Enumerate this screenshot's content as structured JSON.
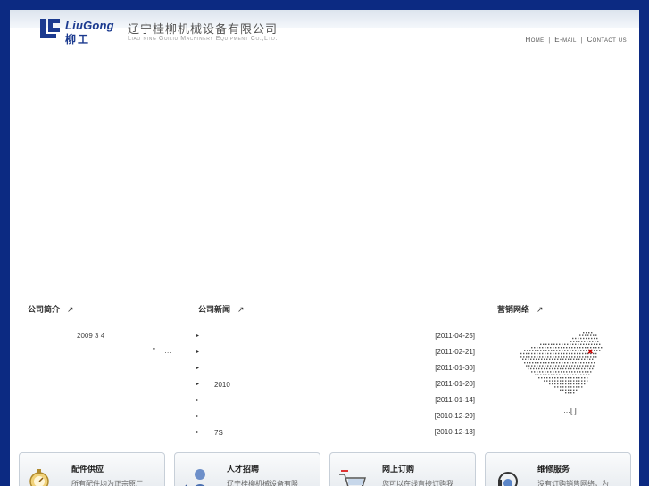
{
  "header": {
    "logo_en": "LiuGong",
    "logo_cn": "柳工",
    "company_name": "辽宁桂柳机械设备有限公司",
    "company_en": "Liao ning Guiliu Machinery Equipment Co.,Ltd.",
    "links": [
      "Home",
      "E-mail",
      "Contact us"
    ],
    "link_separator": "|"
  },
  "intro": {
    "title": "公司简介",
    "arrow": "↗",
    "line1": "2009 3 4",
    "line2": "\" …"
  },
  "news": {
    "title": "公司新闻",
    "arrow": "↗",
    "items": [
      {
        "bullet": "▸",
        "title": "",
        "date": "[2011-04-25]"
      },
      {
        "bullet": "▸",
        "title": "",
        "date": "[2011-02-21]"
      },
      {
        "bullet": "▸",
        "title": "",
        "date": "[2011-01-30]"
      },
      {
        "bullet": "▸",
        "title": "2010",
        "date": "[2011-01-20]"
      },
      {
        "bullet": "▸",
        "title": "",
        "date": "[2011-01-14]"
      },
      {
        "bullet": "▸",
        "title": "",
        "date": "[2010-12-29]"
      },
      {
        "bullet": "▸",
        "title": "7S",
        "date": "[2010-12-13]"
      }
    ]
  },
  "network": {
    "title": "营销网络",
    "arrow": "↗",
    "more": "…[  ]",
    "marker_color": "#cc0000"
  },
  "cards": [
    {
      "title": "配件供应",
      "desc": "所有配件均为正宗原厂",
      "icon": "stopwatch-icon"
    },
    {
      "title": "人才招聘",
      "desc": "辽宁桂柳机械设备有限",
      "icon": "person-icon"
    },
    {
      "title": "网上订购",
      "desc": "您可以在线直接订购我",
      "icon": "cart-icon"
    },
    {
      "title": "维修服务",
      "desc": "没有订购销售网络，为",
      "icon": "headset-icon"
    }
  ],
  "colors": {
    "frame": "#0c2a82",
    "brand_blue": "#1b3a8f"
  }
}
